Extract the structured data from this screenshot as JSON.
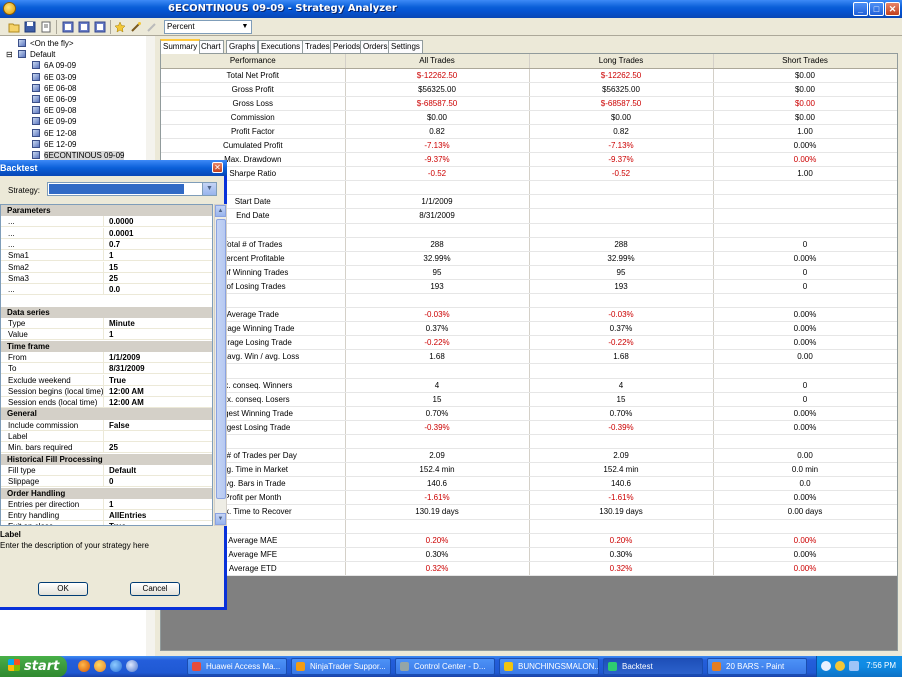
{
  "window": {
    "title": "6ECONTINOUS 09-09 - Strategy Analyzer"
  },
  "toolbar": {
    "display_mode": "Percent"
  },
  "tree": {
    "items": [
      {
        "label": "<On the fly>",
        "level": 0
      },
      {
        "label": "Default",
        "level": 0
      },
      {
        "label": "6A 09-09",
        "level": 1
      },
      {
        "label": "6E 03-09",
        "level": 1
      },
      {
        "label": "6E 06-08",
        "level": 1
      },
      {
        "label": "6E 06-09",
        "level": 1
      },
      {
        "label": "6E 09-08",
        "level": 1
      },
      {
        "label": "6E 09-09",
        "level": 1
      },
      {
        "label": "6E 12-08",
        "level": 1
      },
      {
        "label": "6E 12-09",
        "level": 1
      },
      {
        "label": "6ECONTINOUS 09-09",
        "level": 1
      }
    ]
  },
  "tabs": [
    "Summary",
    "Chart",
    "Graphs",
    "Executions",
    "Trades",
    "Periods",
    "Orders",
    "Settings"
  ],
  "performance": {
    "headers": [
      "Performance",
      "All Trades",
      "Long Trades",
      "Short Trades"
    ],
    "rows": [
      {
        "label": "Total Net Profit",
        "all": "$-12262.50",
        "long": "$-12262.50",
        "short": "$0.00",
        "neg": [
          true,
          true,
          false
        ]
      },
      {
        "label": "Gross Profit",
        "all": "$56325.00",
        "long": "$56325.00",
        "short": "$0.00",
        "neg": [
          false,
          false,
          false
        ]
      },
      {
        "label": "Gross Loss",
        "all": "$-68587.50",
        "long": "$-68587.50",
        "short": "$0.00",
        "neg": [
          true,
          true,
          true
        ]
      },
      {
        "label": "Commission",
        "all": "$0.00",
        "long": "$0.00",
        "short": "$0.00",
        "neg": [
          false,
          false,
          false
        ]
      },
      {
        "label": "Profit Factor",
        "all": "0.82",
        "long": "0.82",
        "short": "1.00",
        "neg": [
          false,
          false,
          false
        ]
      },
      {
        "label": "Cumulated Profit",
        "all": "-7.13%",
        "long": "-7.13%",
        "short": "0.00%",
        "neg": [
          true,
          true,
          false
        ]
      },
      {
        "label": "Max. Drawdown",
        "all": "-9.37%",
        "long": "-9.37%",
        "short": "0.00%",
        "neg": [
          true,
          true,
          true
        ]
      },
      {
        "label": "Sharpe Ratio",
        "all": "-0.52",
        "long": "-0.52",
        "short": "1.00",
        "neg": [
          true,
          true,
          false
        ]
      },
      {
        "label": "",
        "all": "",
        "long": "",
        "short": "",
        "neg": [
          false,
          false,
          false
        ]
      },
      {
        "label": "Start Date",
        "all": "1/1/2009",
        "long": "",
        "short": "",
        "neg": [
          false,
          false,
          false
        ]
      },
      {
        "label": "End Date",
        "all": "8/31/2009",
        "long": "",
        "short": "",
        "neg": [
          false,
          false,
          false
        ]
      },
      {
        "label": "",
        "all": "",
        "long": "",
        "short": "",
        "neg": [
          false,
          false,
          false
        ]
      },
      {
        "label": "Total # of Trades",
        "all": "288",
        "long": "288",
        "short": "0",
        "neg": [
          false,
          false,
          false
        ]
      },
      {
        "label": "Percent Profitable",
        "all": "32.99%",
        "long": "32.99%",
        "short": "0.00%",
        "neg": [
          false,
          false,
          false
        ]
      },
      {
        "label": "# of Winning Trades",
        "all": "95",
        "long": "95",
        "short": "0",
        "neg": [
          false,
          false,
          false
        ]
      },
      {
        "label": "# of Losing Trades",
        "all": "193",
        "long": "193",
        "short": "0",
        "neg": [
          false,
          false,
          false
        ]
      },
      {
        "label": "",
        "all": "",
        "long": "",
        "short": "",
        "neg": [
          false,
          false,
          false
        ]
      },
      {
        "label": "Average Trade",
        "all": "-0.03%",
        "long": "-0.03%",
        "short": "0.00%",
        "neg": [
          true,
          true,
          false
        ]
      },
      {
        "label": "Average Winning Trade",
        "all": "0.37%",
        "long": "0.37%",
        "short": "0.00%",
        "neg": [
          false,
          false,
          false
        ]
      },
      {
        "label": "Average Losing Trade",
        "all": "-0.22%",
        "long": "-0.22%",
        "short": "0.00%",
        "neg": [
          true,
          true,
          false
        ]
      },
      {
        "label": "Ratio avg. Win / avg. Loss",
        "all": "1.68",
        "long": "1.68",
        "short": "0.00",
        "neg": [
          false,
          false,
          false
        ]
      },
      {
        "label": "",
        "all": "",
        "long": "",
        "short": "",
        "neg": [
          false,
          false,
          false
        ]
      },
      {
        "label": "Max. conseq. Winners",
        "all": "4",
        "long": "4",
        "short": "0",
        "neg": [
          false,
          false,
          false
        ]
      },
      {
        "label": "Max. conseq. Losers",
        "all": "15",
        "long": "15",
        "short": "0",
        "neg": [
          false,
          false,
          false
        ]
      },
      {
        "label": "Largest Winning Trade",
        "all": "0.70%",
        "long": "0.70%",
        "short": "0.00%",
        "neg": [
          false,
          false,
          false
        ]
      },
      {
        "label": "Largest Losing Trade",
        "all": "-0.39%",
        "long": "-0.39%",
        "short": "0.00%",
        "neg": [
          true,
          true,
          false
        ]
      },
      {
        "label": "",
        "all": "",
        "long": "",
        "short": "",
        "neg": [
          false,
          false,
          false
        ]
      },
      {
        "label": "Avg. # of Trades per Day",
        "all": "2.09",
        "long": "2.09",
        "short": "0.00",
        "neg": [
          false,
          false,
          false
        ]
      },
      {
        "label": "Avg. Time in Market",
        "all": "152.4 min",
        "long": "152.4 min",
        "short": "0.0 min",
        "neg": [
          false,
          false,
          false
        ]
      },
      {
        "label": "Avg. Bars in Trade",
        "all": "140.6",
        "long": "140.6",
        "short": "0.0",
        "neg": [
          false,
          false,
          false
        ]
      },
      {
        "label": "Profit per Month",
        "all": "-1.61%",
        "long": "-1.61%",
        "short": "0.00%",
        "neg": [
          true,
          true,
          false
        ]
      },
      {
        "label": "Max. Time to Recover",
        "all": "130.19 days",
        "long": "130.19 days",
        "short": "0.00 days",
        "neg": [
          false,
          false,
          false
        ]
      },
      {
        "label": "",
        "all": "",
        "long": "",
        "short": "",
        "neg": [
          false,
          false,
          false
        ]
      },
      {
        "label": "Average MAE",
        "all": "0.20%",
        "long": "0.20%",
        "short": "0.00%",
        "neg": [
          true,
          true,
          true
        ]
      },
      {
        "label": "Average MFE",
        "all": "0.30%",
        "long": "0.30%",
        "short": "0.00%",
        "neg": [
          false,
          false,
          false
        ]
      },
      {
        "label": "Average ETD",
        "all": "0.32%",
        "long": "0.32%",
        "short": "0.00%",
        "neg": [
          true,
          true,
          true
        ]
      }
    ]
  },
  "dialog": {
    "title": "Backtest",
    "strategy_label": "Strategy:",
    "properties": [
      {
        "type": "cat",
        "label": "Parameters"
      },
      {
        "type": "row",
        "name": "...",
        "value": "0.0000"
      },
      {
        "type": "row",
        "name": "...",
        "value": "0.0001"
      },
      {
        "type": "row",
        "name": "...",
        "value": "0.7"
      },
      {
        "type": "row",
        "name": "Sma1",
        "value": "1"
      },
      {
        "type": "row",
        "name": "Sma2",
        "value": "15"
      },
      {
        "type": "row",
        "name": "Sma3",
        "value": "25"
      },
      {
        "type": "row",
        "name": "...",
        "value": "0.0"
      },
      {
        "type": "blank"
      },
      {
        "type": "cat",
        "label": "Data series"
      },
      {
        "type": "row",
        "name": "Type",
        "value": "Minute"
      },
      {
        "type": "row",
        "name": "Value",
        "value": "1"
      },
      {
        "type": "cat",
        "label": "Time frame"
      },
      {
        "type": "row",
        "name": "From",
        "value": "1/1/2009"
      },
      {
        "type": "row",
        "name": "To",
        "value": "8/31/2009"
      },
      {
        "type": "row",
        "name": "Exclude weekend",
        "value": "True"
      },
      {
        "type": "row",
        "name": "Session begins (local time)",
        "value": "12:00 AM"
      },
      {
        "type": "row",
        "name": "Session ends (local time)",
        "value": "12:00 AM"
      },
      {
        "type": "cat",
        "label": "General"
      },
      {
        "type": "row",
        "name": "Include commission",
        "value": "False"
      },
      {
        "type": "row",
        "name": "Label",
        "value": ""
      },
      {
        "type": "row",
        "name": "Min. bars required",
        "value": "25"
      },
      {
        "type": "cat",
        "label": "Historical Fill Processing"
      },
      {
        "type": "row",
        "name": "Fill type",
        "value": "Default"
      },
      {
        "type": "row",
        "name": "Slippage",
        "value": "0"
      },
      {
        "type": "cat",
        "label": "Order Handling"
      },
      {
        "type": "row",
        "name": "Entries per direction",
        "value": "1"
      },
      {
        "type": "row",
        "name": "Entry handling",
        "value": "AllEntries"
      },
      {
        "type": "row",
        "name": "Exit on close",
        "value": "True"
      }
    ],
    "description_title": "Label",
    "description_text": "Enter the description of your strategy here",
    "ok_label": "OK",
    "cancel_label": "Cancel"
  },
  "taskbar": {
    "start_label": "start",
    "tasks": [
      "Huawei Access Ma...",
      "NinjaTrader Suppor...",
      "Control Center - D...",
      "BUNCHINGSMALON...",
      "Backtest",
      "20 BARS - Paint"
    ],
    "clock": "7:56 PM"
  },
  "colors": {
    "negative": "#cc0000",
    "xp_blue": "#0a5fd8",
    "start_green": "#3c9a3c"
  }
}
